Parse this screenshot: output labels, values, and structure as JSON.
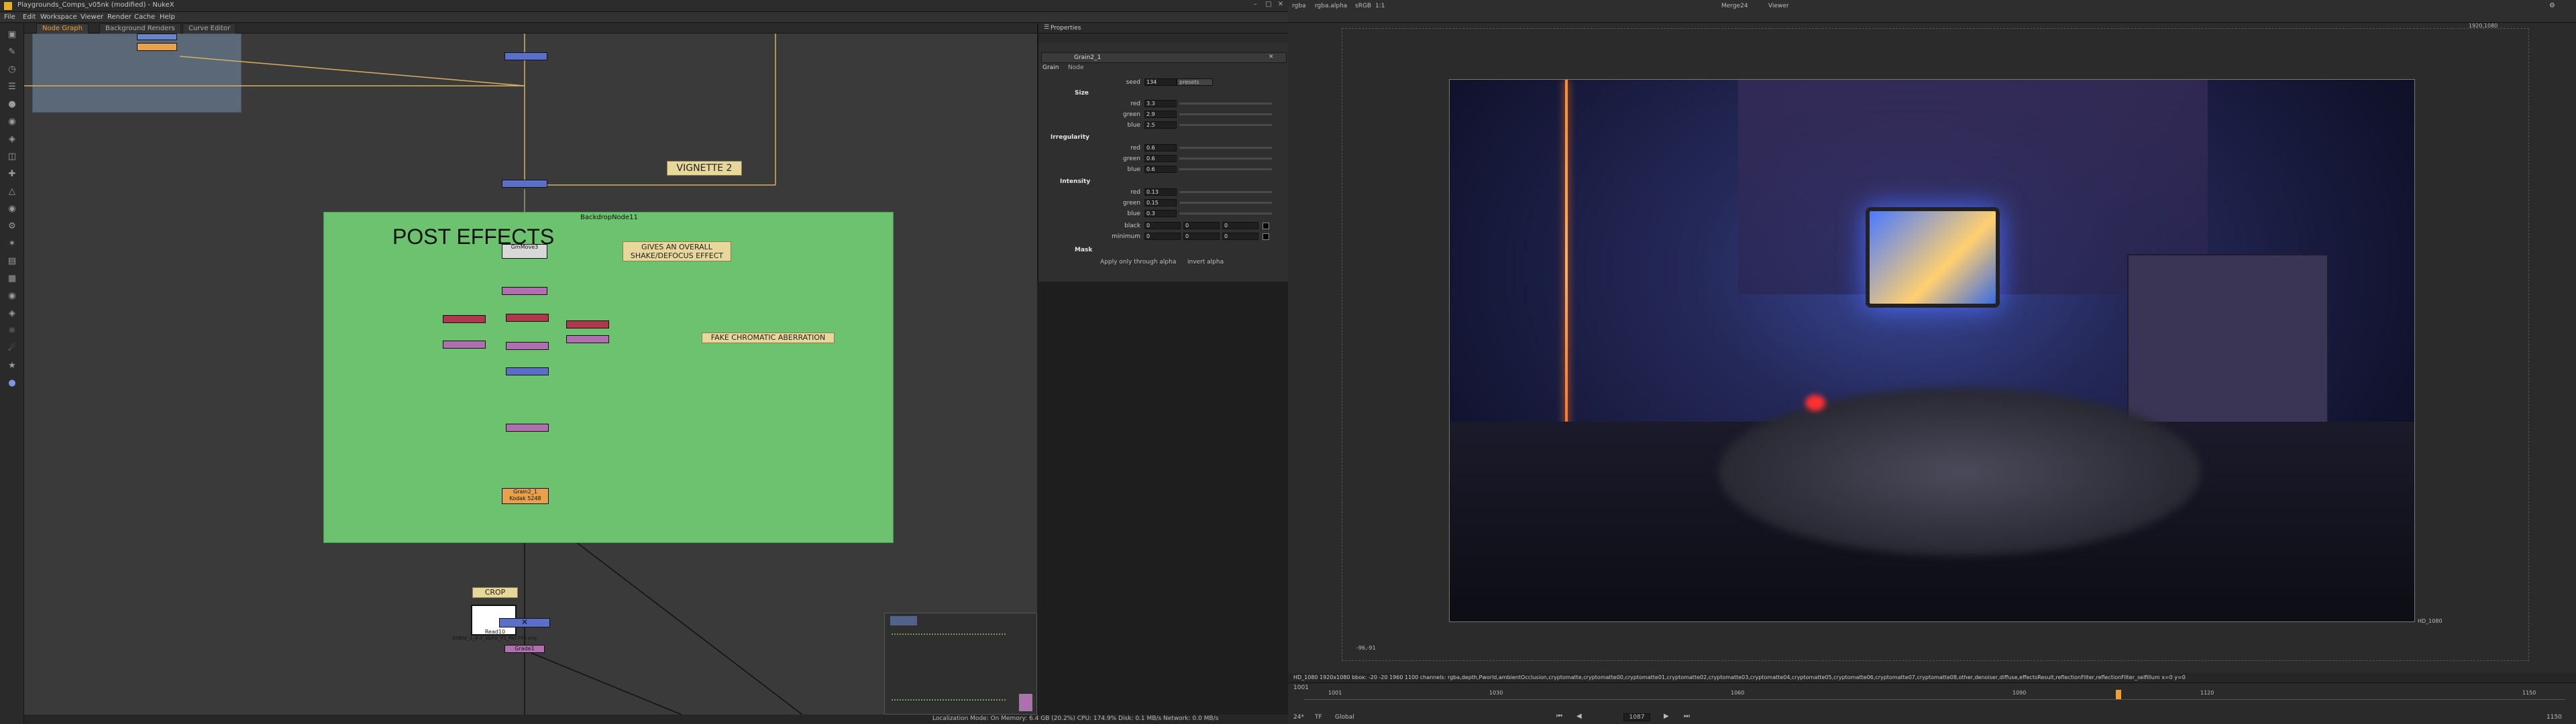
{
  "window": {
    "title": "Playgrounds_Comps_v05nk (modified) - NukeX"
  },
  "menu": [
    "File",
    "Edit",
    "Workspace",
    "Viewer",
    "Render",
    "Cache",
    "Help"
  ],
  "tabs": [
    {
      "label": "Node Graph"
    },
    {
      "label": "Background Renders"
    },
    {
      "label": "Curve Editor"
    }
  ],
  "nodegraph": {
    "backdrop_post": {
      "label": "POST EFFECTS",
      "name": "BackdropNode11"
    },
    "sticky_vignette": "VIGNETTE 2",
    "sticky_shake": "GIVES AN OVERALL SHAKE/DEFOCUS EFFECT",
    "sticky_chroma": "FAKE CHROMATIC ABERRATION",
    "sticky_crop": "CROP",
    "node_camshake": "GmMove3",
    "node_grain": "Grain2_1",
    "node_grain_sub": "Kodak 5248",
    "node_read": "Read10",
    "node_read_sub": "1080p_1_4-3_alpha_V1_Rec709.png",
    "node_grade": "Grade1",
    "node_dissolve": "Dissolve"
  },
  "properties": {
    "panel_title": "Properties",
    "node_name": "Grain2_1",
    "tabs": [
      "Grain",
      "Node"
    ],
    "seed_label": "seed",
    "seed_value": "134",
    "presets_label": "presets",
    "size_title": "Size",
    "size": [
      {
        "label": "red",
        "value": "3.3"
      },
      {
        "label": "green",
        "value": "2.9"
      },
      {
        "label": "blue",
        "value": "2.5"
      }
    ],
    "irregularity_title": "Irregularity",
    "irregularity": [
      {
        "label": "red",
        "value": "0.6"
      },
      {
        "label": "green",
        "value": "0.6"
      },
      {
        "label": "blue",
        "value": "0.6"
      }
    ],
    "intensity_title": "Intensity",
    "intensity": [
      {
        "label": "red",
        "value": "0.13"
      },
      {
        "label": "green",
        "value": "0.15"
      },
      {
        "label": "blue",
        "value": "0.3"
      }
    ],
    "black_label": "black",
    "black_values": [
      "0",
      "0",
      "0"
    ],
    "minimum_label": "minimum",
    "minimum_values": [
      "0",
      "0",
      "0"
    ],
    "mask_label": "Mask",
    "apply_label": "Apply only through alpha",
    "invert_label": "invert alpha"
  },
  "viewer": {
    "channels": "rgba",
    "alpha": "rgba.alpha",
    "colorspace": "sRGB",
    "zoom": "1:1",
    "input_b": "Merge24",
    "input_a": "Viewer",
    "format_label": "HD_1080",
    "coord_bl": "-96,-91",
    "coord_tr": "1920,1080",
    "info": "HD_1080 1920x1080  bbox: -20 -20 1960 1100 channels: rgba,depth,Pworld,ambientOcclusion,cryptomatte,cryptomatte00,cryptomatte01,cryptomatte02,cryptomatte03,cryptomatte04,cryptomatte05,cryptomatte06,cryptomatte07,cryptomatte08,other,denoiser,diffuse,effectsResult,reflectionFilter,reflectionFilter_selfillum  x=0 y=0"
  },
  "timeline": {
    "fps": "24*",
    "mode": "TF",
    "global": "Global",
    "frame_start": "1001",
    "frame_end": "1150",
    "current_frame": "1087",
    "tick_labels": [
      "1001",
      "1030",
      "1060",
      "1090",
      "1120",
      "1150"
    ]
  },
  "status": "Localization Mode: On  Memory: 6.4 GB (20.2%)  CPU: 174.9%  Disk: 0.1 MB/s  Network: 0.0 MB/s"
}
